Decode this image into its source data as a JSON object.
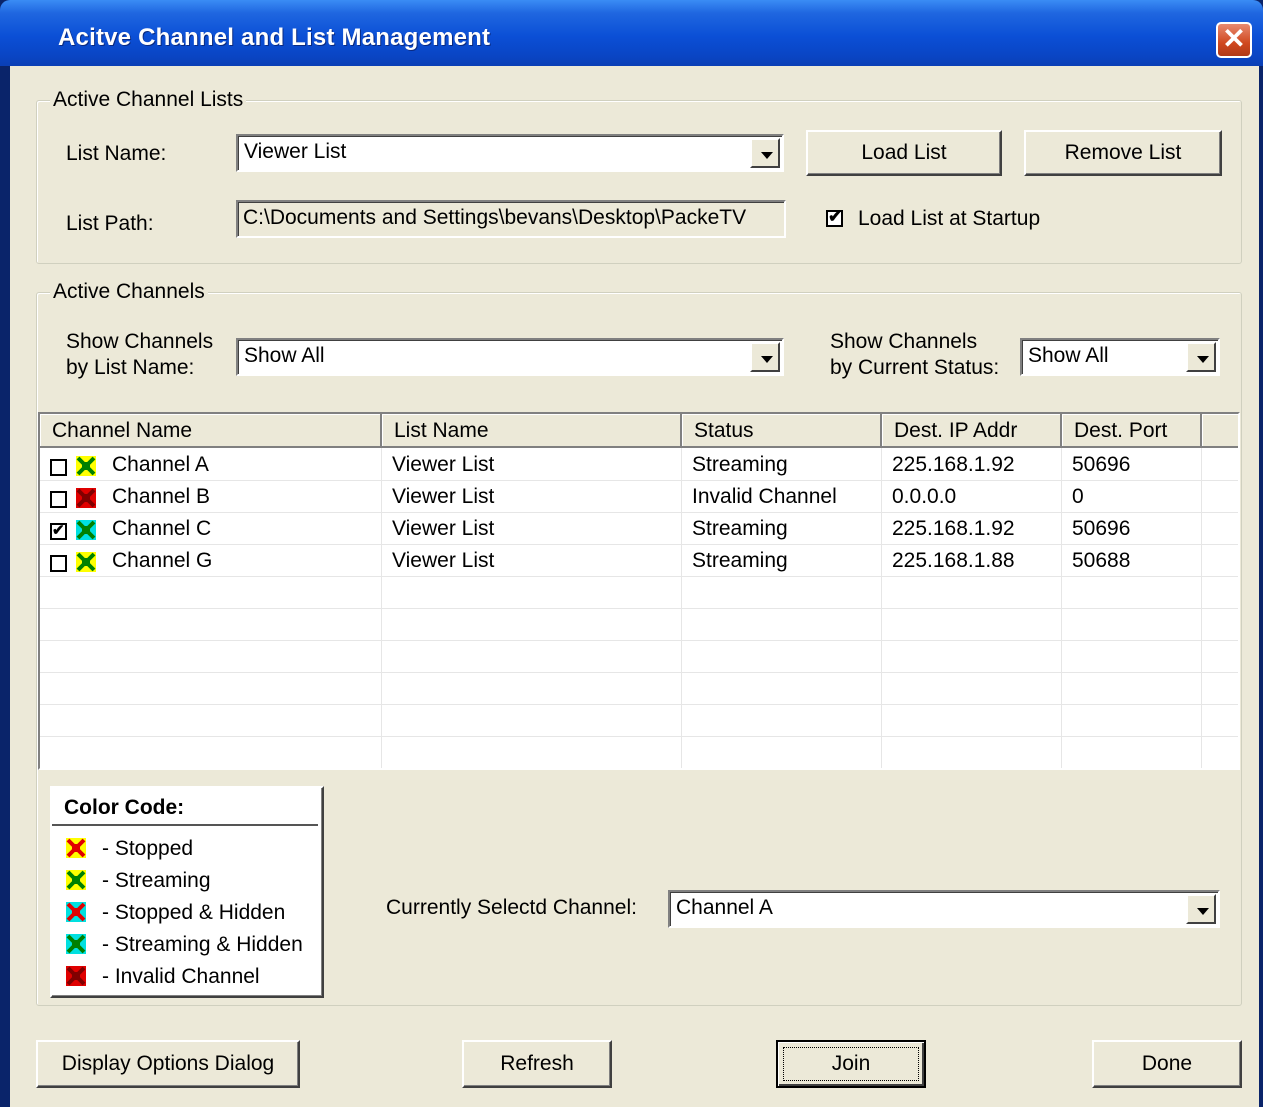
{
  "window": {
    "title": "Acitve Channel and List Management",
    "close_glyph": "✕"
  },
  "active_channel_lists": {
    "legend": "Active Channel Lists",
    "list_name_label": "List Name:",
    "list_name_value": "Viewer List",
    "list_path_label": "List Path:",
    "list_path_value": "C:\\Documents and Settings\\bevans\\Desktop\\PackeTV",
    "load_list_button": "Load List",
    "remove_list_button": "Remove List",
    "load_at_startup_label": "Load List at Startup",
    "load_at_startup_checked": true
  },
  "active_channels": {
    "legend": "Active Channels",
    "show_by_list_label_1": "Show Channels",
    "show_by_list_label_2": "by List Name:",
    "show_by_list_value": "Show All",
    "show_by_status_label_1": "Show Channels",
    "show_by_status_label_2": "by Current Status:",
    "show_by_status_value": "Show All"
  },
  "table": {
    "columns": [
      "Channel Name",
      "List Name",
      "Status",
      "Dest. IP Addr",
      "Dest. Port"
    ],
    "rows": [
      {
        "checked": false,
        "icon": "streaming-icon",
        "name": "Channel A",
        "list": "Viewer List",
        "status": "Streaming",
        "ip": "225.168.1.92",
        "port": "50696"
      },
      {
        "checked": false,
        "icon": "invalid-icon",
        "name": "Channel B",
        "list": "Viewer List",
        "status": "Invalid Channel",
        "ip": "0.0.0.0",
        "port": "0"
      },
      {
        "checked": true,
        "icon": "streaming-hidden-icon",
        "name": "Channel C",
        "list": "Viewer List",
        "status": "Streaming",
        "ip": "225.168.1.92",
        "port": "50696"
      },
      {
        "checked": false,
        "icon": "streaming-icon",
        "name": "Channel G",
        "list": "Viewer List",
        "status": "Streaming",
        "ip": "225.168.1.88",
        "port": "50688"
      }
    ]
  },
  "color_code": {
    "title": "Color Code:",
    "items": [
      {
        "icon": "stopped-icon",
        "label": "- Stopped"
      },
      {
        "icon": "streaming-icon",
        "label": "- Streaming"
      },
      {
        "icon": "stopped-hidden-icon",
        "label": "- Stopped & Hidden"
      },
      {
        "icon": "streaming-hidden-icon",
        "label": "- Streaming & Hidden"
      },
      {
        "icon": "invalid-icon",
        "label": "- Invalid Channel"
      }
    ]
  },
  "icon_colors": {
    "stopped-icon": {
      "bg": "#ffff00",
      "fg": "#e00000"
    },
    "streaming-icon": {
      "bg": "#ffff00",
      "fg": "#008000"
    },
    "stopped-hidden-icon": {
      "bg": "#00e0e0",
      "fg": "#e00000"
    },
    "streaming-hidden-icon": {
      "bg": "#00e0e0",
      "fg": "#008000"
    },
    "invalid-icon": {
      "bg": "#e00000",
      "fg": "#800000"
    }
  },
  "selected_channel": {
    "label": "Currently Selectd Channel:",
    "value": "Channel A"
  },
  "buttons": {
    "display_options": "Display Options Dialog",
    "refresh": "Refresh",
    "join": "Join",
    "done": "Done"
  }
}
